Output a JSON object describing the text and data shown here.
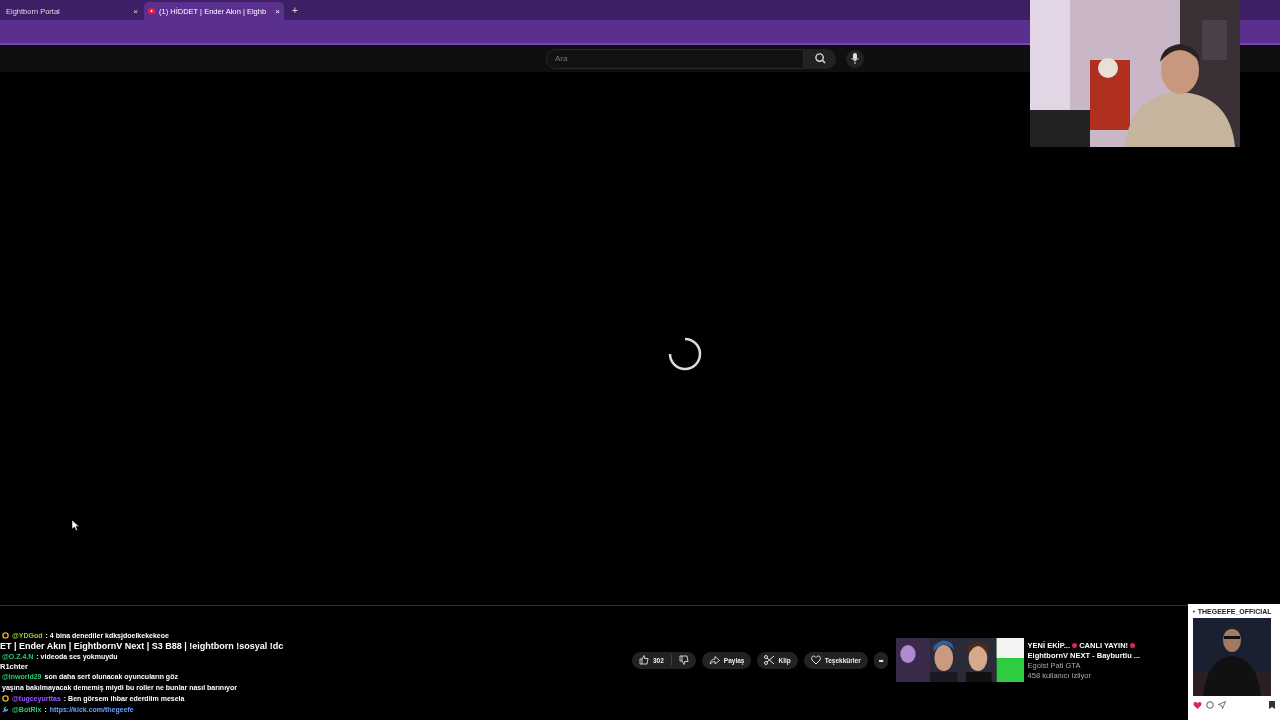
{
  "tabs": [
    {
      "title": "Eightborn Portal",
      "selected": false,
      "kind": "page",
      "close": "×"
    },
    {
      "title": "(1) HİDDET | Ender Akın | Eighb",
      "selected": true,
      "kind": "video",
      "close": "×"
    }
  ],
  "new_tab": "+",
  "search": {
    "placeholder": "Ara"
  },
  "player": {
    "loading": true
  },
  "stream_title": "ET | Ender Akın | EightbornV Next | S3 B88 | !eightborn !sosyal !dc",
  "chat": [
    {
      "kind": "badged",
      "user": "@YDGod",
      "color": "#9acd32",
      "text": ": 4 bina denediler kdksjdoelkekekeoe"
    },
    {
      "kind": "title"
    },
    {
      "kind": "message",
      "user": "@O.Z.4.N",
      "color": "#2ecc71",
      "text": ": videoda ses yokmuydu"
    },
    {
      "kind": "label",
      "text": "R1chter"
    },
    {
      "kind": "message",
      "user": "@inworld29",
      "color": "#2ecc71",
      "text": "son daha sert olunacak oyuncuların göz"
    },
    {
      "kind": "continuation",
      "text": "yaşına bakılmayacak dememiş miydi bu roller ne bunlar nasıl barınıyor"
    },
    {
      "kind": "badged",
      "user": "@tugceyurttas",
      "color": "#9b59ff",
      "text": ": Ben görsem ihbar ederdiim mesela"
    },
    {
      "kind": "bot",
      "user": "@BotRix",
      "color": "#2ecc71",
      "text": ":",
      "link": "https://kick.com/thegeefe"
    }
  ],
  "actions": {
    "likes": "302",
    "buttons": [
      {
        "kind": "share",
        "label": "Paylaş"
      },
      {
        "kind": "clip",
        "label": "Klip"
      },
      {
        "kind": "thanks",
        "label": "Teşekkürler"
      }
    ],
    "more": "•••"
  },
  "recommended": {
    "headline": "YENİ EKİP...",
    "live": "CANLI YAYIN!",
    "title": "EightbornV NEXT - Bayburtlu ...",
    "channel": "Egoist Pati GTA",
    "viewers": "458 kullanıcı izliyor"
  },
  "post": {
    "username": "THEGEEFE_OFFICIAL"
  }
}
